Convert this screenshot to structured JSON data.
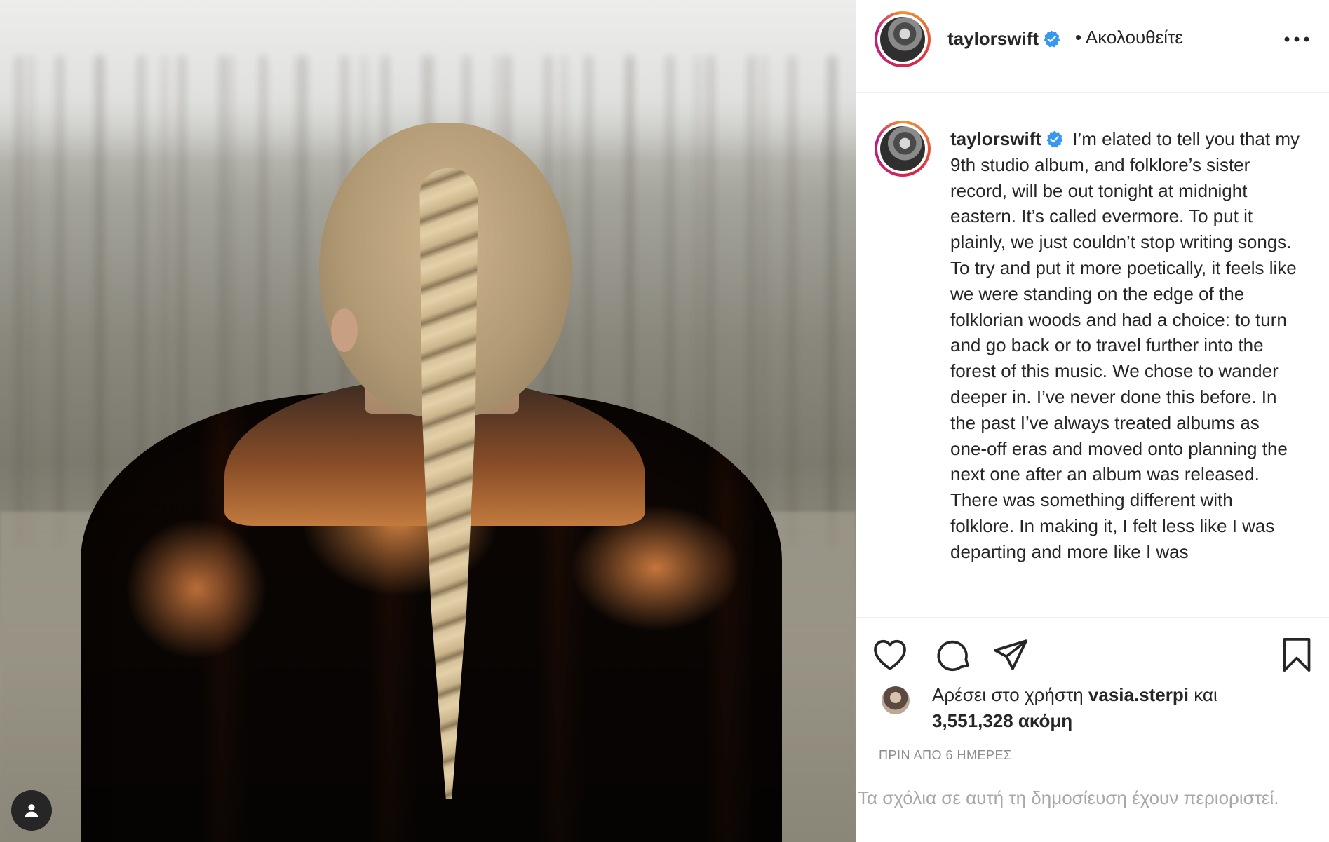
{
  "photo": {
    "alt": "",
    "user_tag_icon": "person-icon"
  },
  "header": {
    "username": "taylorswift",
    "verified_icon": "verified-badge-icon",
    "follow_status": "• Ακολουθείτε",
    "more_icon": "more-options-icon"
  },
  "caption": {
    "username": "taylorswift",
    "text": "I’m elated to tell you that my 9th studio album, and folklore’s sister record, will be out tonight at midnight eastern. It’s called evermore. To put it plainly, we just couldn’t stop writing songs. To try and put it more poetically, it feels like we were standing on the edge of the folklorian woods and had a choice: to turn and go back or to travel further into the forest of this music. We chose to wander deeper in. I’ve never done this before. In the past I’ve always treated albums as one-off eras and moved onto planning the next one after an album was released. There was something different with folklore. In making it, I felt less like I was departing and more like I was"
  },
  "actions": {
    "like_icon": "heart-icon",
    "comment_icon": "comment-bubble-icon",
    "share_icon": "paper-plane-icon",
    "save_icon": "bookmark-icon"
  },
  "likes": {
    "prefix": "Αρέσει στο χρήστη",
    "user": "vasia.sterpi",
    "joiner": "και",
    "count": "3,551,328 ακόμη"
  },
  "timestamp": "ΠΡΙΝ ΑΠΟ 6 ΗΜΕΡΕΣ",
  "comments_notice": "Τα σχόλια σε αυτή τη δημοσίευση έχουν περιοριστεί."
}
